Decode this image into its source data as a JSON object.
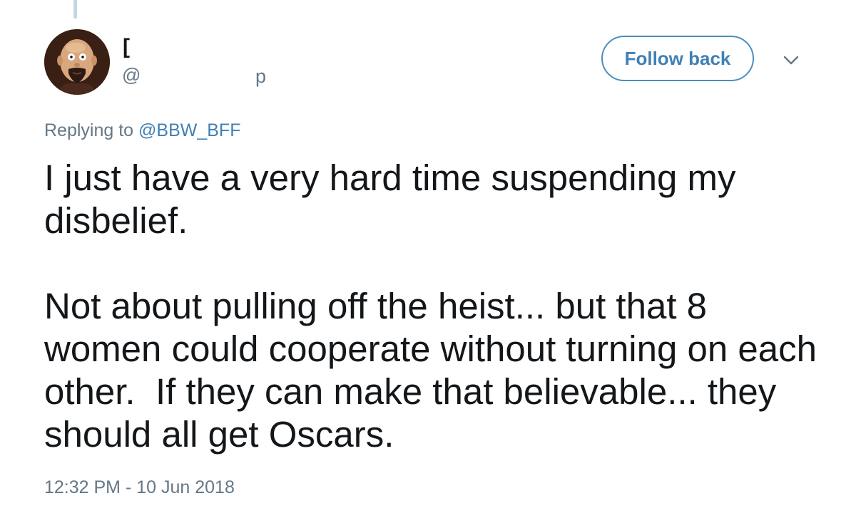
{
  "thread": {
    "connector": "thread-line"
  },
  "author": {
    "display_name": "[",
    "handle_prefix": "@",
    "handle_suffix": "p",
    "avatar_icon": "avatar-cartoon-bald-man"
  },
  "actions": {
    "follow_label": "Follow back",
    "caret_icon": "chevron-down-icon"
  },
  "reply": {
    "prefix": "Replying to ",
    "mention": "@BBW_BFF"
  },
  "tweet": {
    "text": "I just have a very hard time suspending my disbelief.\n\nNot about pulling off the heist... but that 8 women could cooperate without turning on each other.  If they can make that believable... they should all get Oscars.",
    "timestamp": "12:32 PM - 10 Jun 2018"
  },
  "colors": {
    "link": "#3f80b5",
    "secondary_text": "#657786",
    "primary_text": "#14171a",
    "thread_line": "#c4d6e4"
  }
}
